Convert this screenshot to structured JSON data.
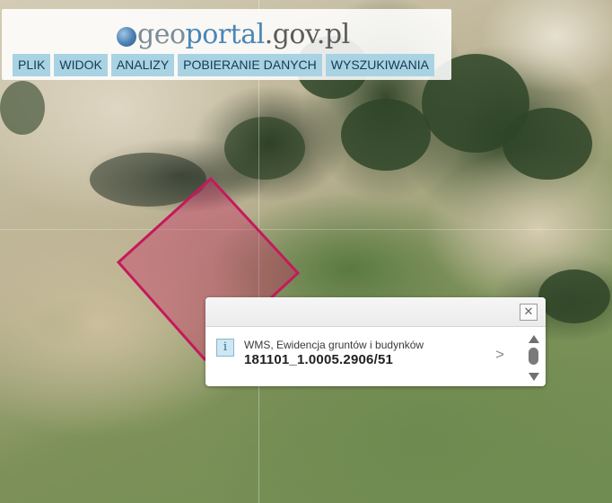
{
  "header": {
    "logo": {
      "geo": "geo",
      "portal": "portal",
      "domain": ".gov.pl"
    },
    "menu": [
      {
        "label": "PLIK"
      },
      {
        "label": "WIDOK"
      },
      {
        "label": "ANALIZY"
      },
      {
        "label": "POBIERANIE DANYCH"
      },
      {
        "label": "WYSZUKIWANIA"
      }
    ]
  },
  "map": {
    "imagery": "aerial-orthophoto",
    "parcel_color": "#cc1a5e"
  },
  "popup": {
    "close_symbol": "✕",
    "result": {
      "icon_glyph": "i",
      "layer_label": "WMS, Ewidencja gruntów i budynków",
      "parcel_id": "181101_1.0005.2906/51",
      "more_glyph": ">"
    }
  },
  "colors": {
    "menu_bg": "#a9d3e3",
    "menu_text": "#133b55",
    "logo_blue": "#4b86b6",
    "parcel_outline": "#c41a5c"
  }
}
